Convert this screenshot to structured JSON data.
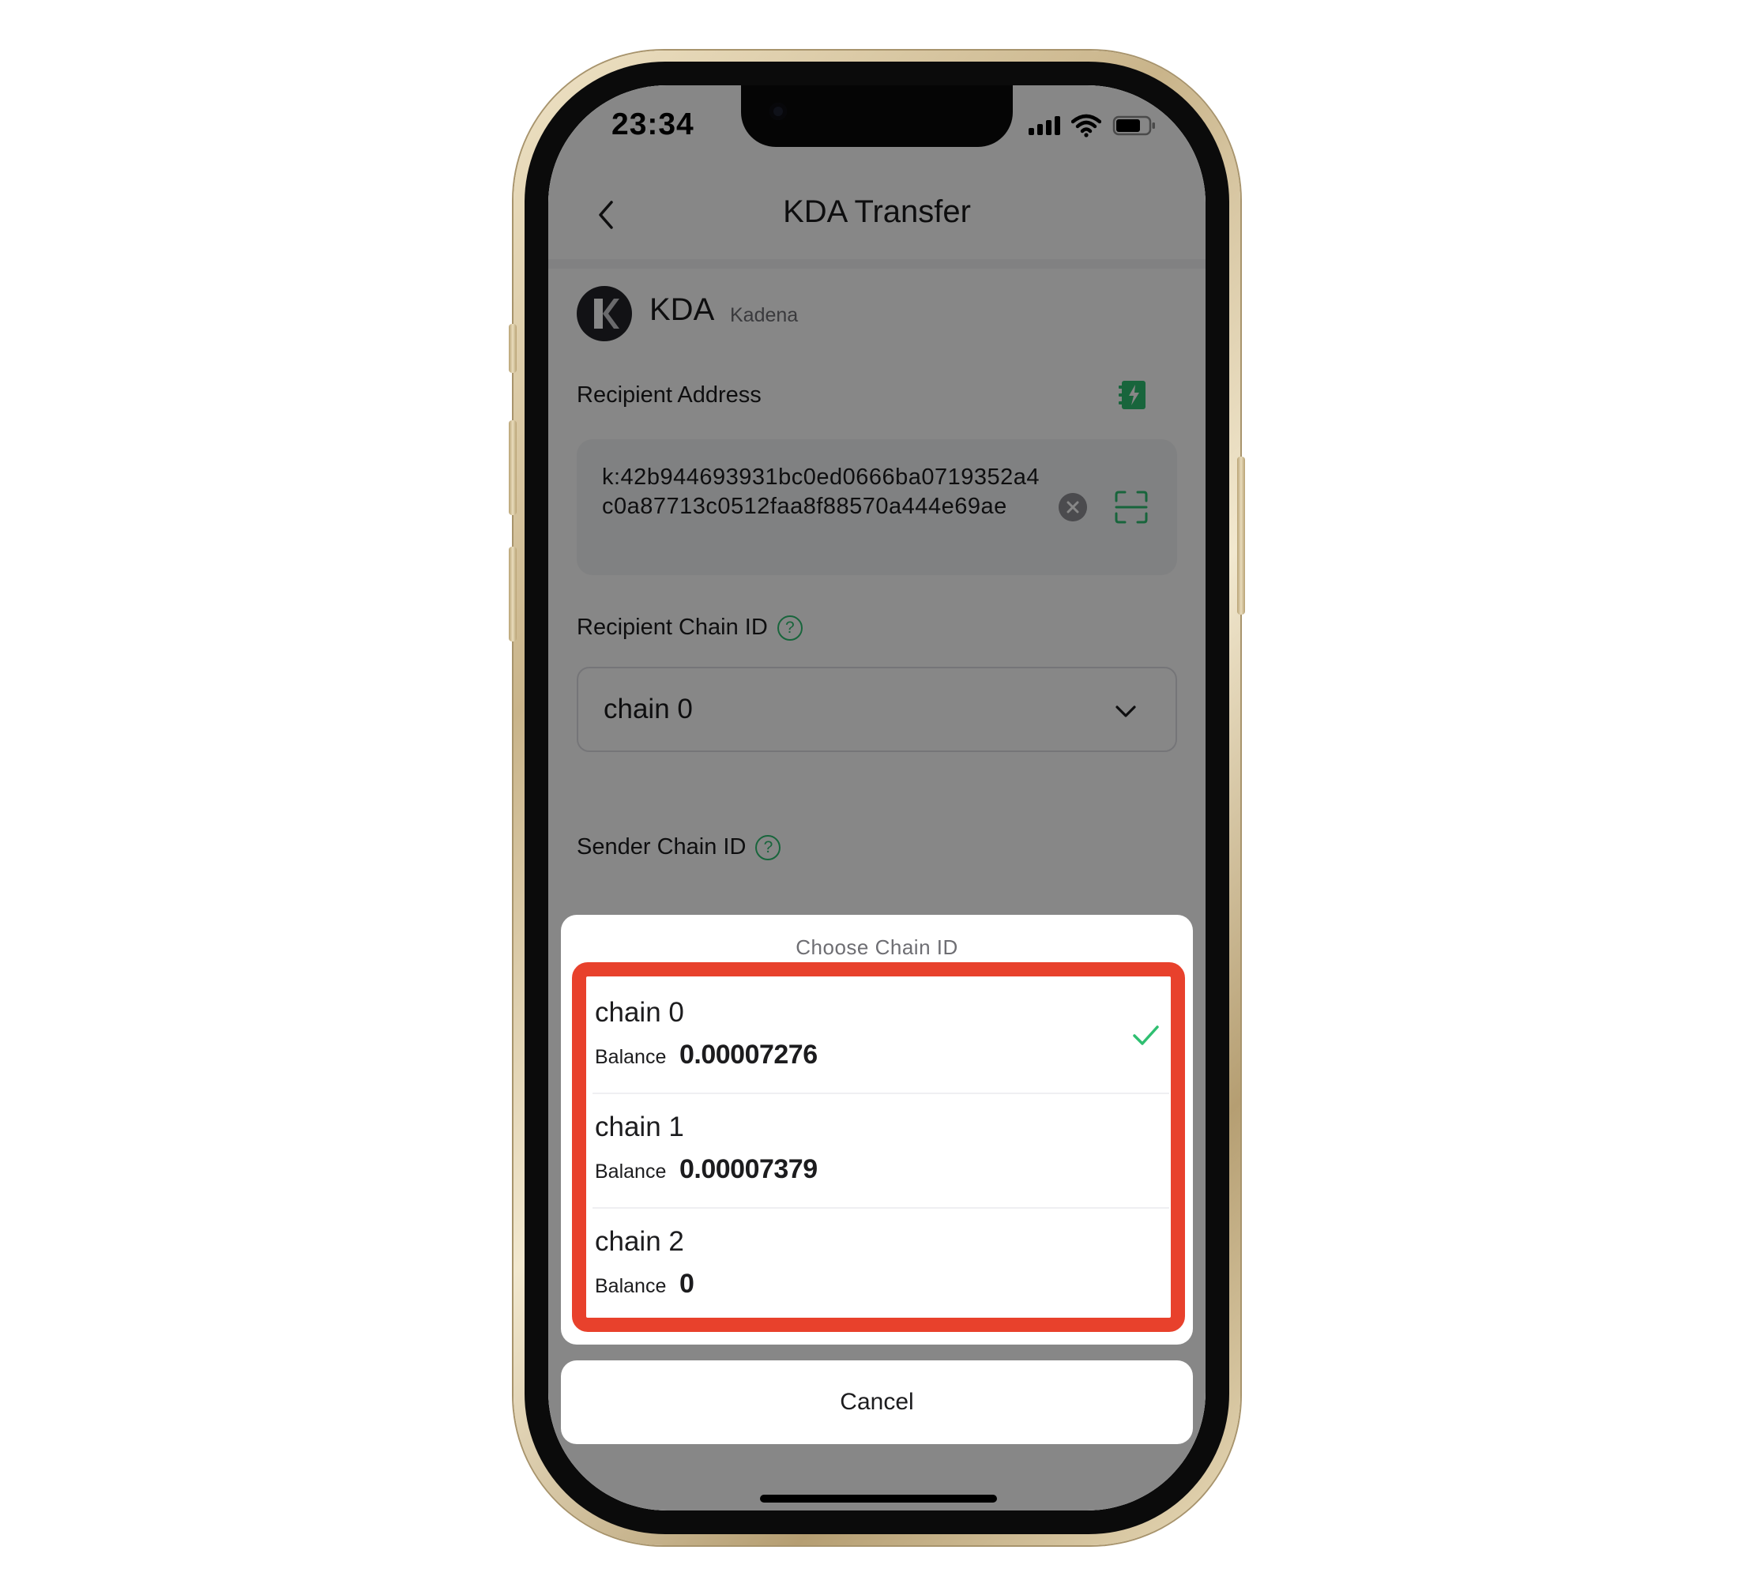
{
  "status_bar": {
    "time": "23:34"
  },
  "header": {
    "title": "KDA Transfer"
  },
  "token": {
    "logo_letter": "K",
    "symbol": "KDA",
    "name": "Kadena"
  },
  "form": {
    "recipient_address_label": "Recipient Address",
    "recipient_address_value": "k:42b944693931bc0ed0666ba0719352a4c0a87713c0512faa8f88570a444e69ae",
    "recipient_chain_label": "Recipient Chain ID",
    "recipient_chain_value": "chain 0",
    "sender_chain_label": "Sender Chain ID",
    "help_glyph": "?"
  },
  "modal": {
    "title": "Choose Chain ID",
    "balance_label": "Balance",
    "options": [
      {
        "name": "chain 0",
        "balance": "0.00007276",
        "selected": true
      },
      {
        "name": "chain 1",
        "balance": "0.00007379",
        "selected": false
      },
      {
        "name": "chain 2",
        "balance": "0",
        "selected": false
      }
    ],
    "cancel_label": "Cancel"
  },
  "colors": {
    "accent_green": "#2fbf71",
    "highlight_red": "#e8412c",
    "overlay": "rgba(0,0,0,0.47)"
  },
  "icons": [
    "back-chevron-icon",
    "address-book-icon",
    "clear-icon",
    "scan-icon",
    "help-icon",
    "chevron-down-icon",
    "check-icon",
    "signal-icon",
    "wifi-icon",
    "battery-icon"
  ]
}
